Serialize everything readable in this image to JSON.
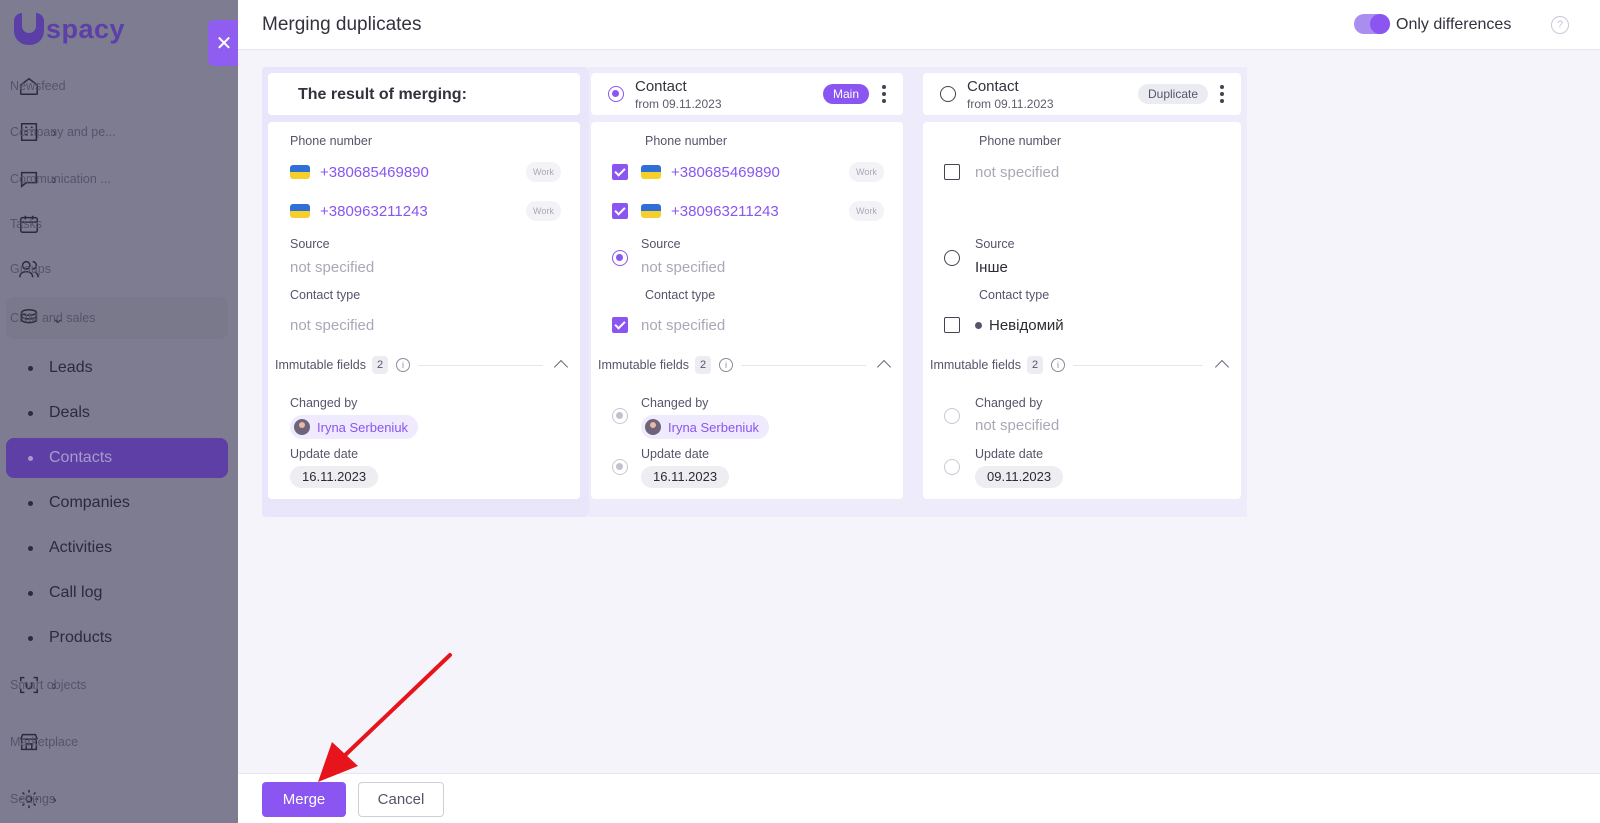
{
  "app": {
    "logo_text": "spacy"
  },
  "sidebar": {
    "items": [
      {
        "label": "Newsfeed",
        "icon": "home-icon"
      },
      {
        "label": "Company and pe...",
        "icon": "building-icon"
      },
      {
        "label": "Communication ...",
        "icon": "chat-icon"
      },
      {
        "label": "Tasks",
        "icon": "calendar-icon"
      },
      {
        "label": "Groups",
        "icon": "users-icon"
      },
      {
        "label": "CRM and sales",
        "icon": "coins-icon"
      },
      {
        "label": "Smart objects",
        "icon": "smart-object-icon"
      },
      {
        "label": "Marketplace",
        "icon": "store-icon"
      },
      {
        "label": "Settings",
        "icon": "gear-icon"
      }
    ],
    "crm_sub": [
      "Leads",
      "Deals",
      "Contacts",
      "Companies",
      "Activities",
      "Call log",
      "Products"
    ],
    "active_sub": "Contacts"
  },
  "header": {
    "title": "Merging duplicates",
    "toggle_label": "Only differences",
    "toggle_on": true
  },
  "labels": {
    "phone_number": "Phone number",
    "source": "Source",
    "contact_type": "Contact type",
    "immutable_fields": "Immutable fields",
    "immutable_count": "2",
    "changed_by": "Changed by",
    "update_date": "Update date",
    "work": "Work",
    "not_specified": "not specified"
  },
  "result": {
    "title": "The result of merging:",
    "phones": [
      "+380685469890",
      "+380963211243"
    ],
    "source": "not specified",
    "contact_type": "not specified",
    "changed_by": "Iryna Serbeniuk",
    "update_date": "16.11.2023"
  },
  "main_contact": {
    "name": "Contact",
    "date": "from 09.11.2023",
    "badge": "Main",
    "phones": [
      "+380685469890",
      "+380963211243"
    ],
    "source": "not specified",
    "contact_type": "not specified",
    "changed_by": "Iryna Serbeniuk",
    "update_date": "16.11.2023"
  },
  "duplicate_contact": {
    "name": "Contact",
    "date": "from 09.11.2023",
    "badge": "Duplicate",
    "phone": "not specified",
    "source": "Інше",
    "contact_type": "Невідомий",
    "changed_by": "not specified",
    "update_date": "09.11.2023"
  },
  "footer": {
    "merge_label": "Merge",
    "cancel_label": "Cancel"
  },
  "colors": {
    "accent": "#8a55f0",
    "annotation_arrow": "#e8141b"
  }
}
